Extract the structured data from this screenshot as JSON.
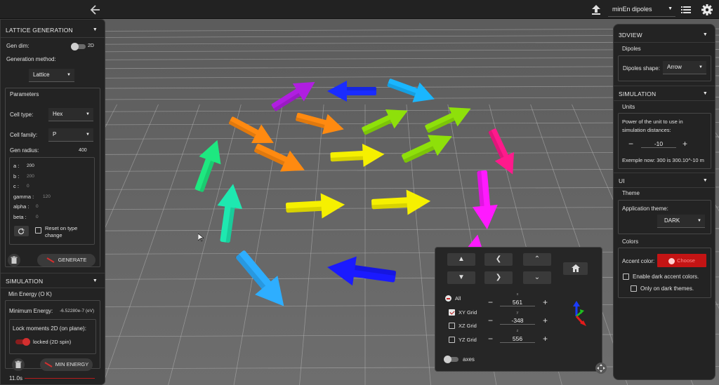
{
  "topbar": {
    "project_name": "minEn dipoles",
    "icons": [
      "back-arrow-icon",
      "upload-icon",
      "list-icon",
      "gear-icon"
    ]
  },
  "left_panel": {
    "lattice": {
      "header": "LATTICE GENERATION",
      "gen_dim_label": "Gen dim:",
      "gen_dim_value": "2D",
      "method_label": "Generation method:",
      "method_value": "Lattice",
      "params_title": "Parameters",
      "cell_type_label": "Cell type:",
      "cell_type_value": "Hex",
      "cell_family_label": "Cell family:",
      "cell_family_value": "P",
      "gen_radius_label": "Gen radius:",
      "gen_radius_value": "400",
      "params": [
        {
          "label": "a :",
          "value": "200",
          "dim": false
        },
        {
          "label": "b :",
          "value": "200",
          "dim": true
        },
        {
          "label": "c :",
          "value": "0",
          "dim": true
        },
        {
          "label": "gamma :",
          "value": "120",
          "dim": true
        },
        {
          "label": "alpha :",
          "value": "0",
          "dim": true
        },
        {
          "label": "beta :",
          "value": "0",
          "dim": true
        }
      ],
      "reset_label": "Reset on type change",
      "generate_label": "GENERATE"
    },
    "simulation": {
      "header": "SIMULATION",
      "energy_title": "Min Energy (O K)",
      "min_energy_label": "Minimum Energy:",
      "min_energy_value": "-6.52280e-7 (eV)",
      "lock_title": "Lock moments 2D (on plane):",
      "lock_value": "locked (2D spin)",
      "min_energy_button": "MIN ENERGY",
      "time_value": "11.0s"
    }
  },
  "right_panel": {
    "view3d": {
      "header": "3DVIEW",
      "dipoles_title": "Dipoles",
      "shape_label": "Dipoles shape:",
      "shape_value": "Arrow"
    },
    "simulation": {
      "header": "SIMULATION",
      "units_title": "Units",
      "power_text": "Power of the unit to use in simulation distances:",
      "power_value": "-10",
      "example_text": "Exemple now: 300 is 300.10^-10 m"
    },
    "ui": {
      "header": "UI",
      "theme_title": "Theme",
      "app_theme_label": "Application theme:",
      "app_theme_value": "DARK",
      "colors_title": "Colors",
      "accent_label": "Accent color:",
      "accent_button": "Choose",
      "accent_color": "#c41414",
      "enable_dark_label": "Enable dark accent colors.",
      "only_dark_label": "Only on dark themes."
    }
  },
  "camera_panel": {
    "grids": [
      {
        "label": "All",
        "state": "minus"
      },
      {
        "label": "XY Grid",
        "state": "checked"
      },
      {
        "label": "XZ Grid",
        "state": "unchecked"
      },
      {
        "label": "YZ Grid",
        "state": "unchecked"
      }
    ],
    "coords": [
      {
        "axis": "x",
        "value": "561"
      },
      {
        "axis": "y",
        "value": "-348"
      },
      {
        "axis": "z",
        "value": "556"
      }
    ],
    "axes_label": "axes"
  }
}
